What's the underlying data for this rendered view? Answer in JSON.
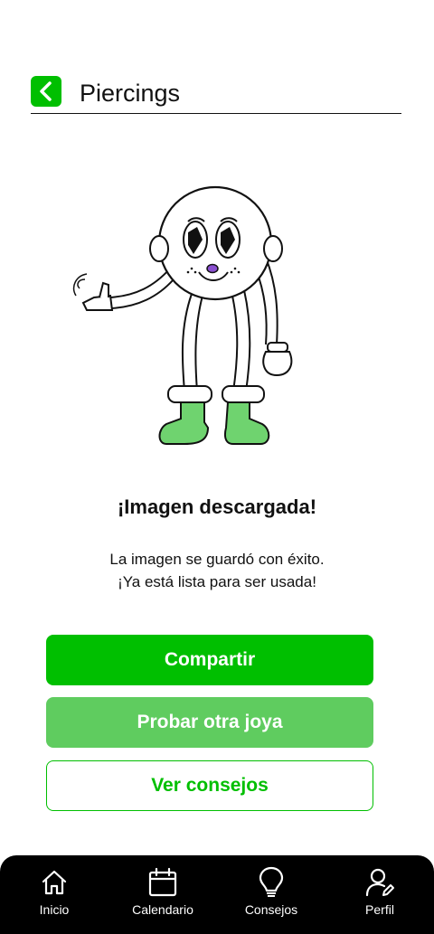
{
  "header": {
    "title": "Piercings",
    "back_icon": "chevron-left-icon"
  },
  "content": {
    "headline": "¡Imagen descargada!",
    "message_line1": "La imagen se guardó con éxito.",
    "message_line2": "¡Ya está lista para ser usada!"
  },
  "actions": {
    "share_label": "Compartir",
    "try_other_label": "Probar otra joya",
    "tips_label": "Ver consejos"
  },
  "nav": {
    "items": [
      {
        "label": "Inicio",
        "icon": "home-icon"
      },
      {
        "label": "Calendario",
        "icon": "calendar-icon"
      },
      {
        "label": "Consejos",
        "icon": "lightbulb-icon"
      },
      {
        "label": "Perfil",
        "icon": "user-edit-icon"
      }
    ]
  },
  "colors": {
    "accent": "#00bf00",
    "accent_light": "#5fcc5f",
    "nav_bg": "#000000"
  }
}
